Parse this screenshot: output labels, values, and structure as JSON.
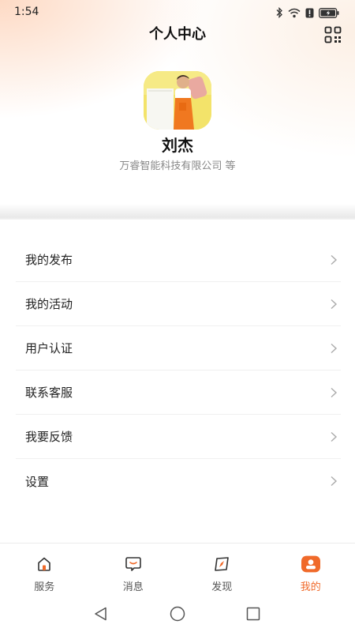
{
  "status_bar": {
    "time": "1:54"
  },
  "header": {
    "title": "个人中心"
  },
  "profile": {
    "name": "刘杰",
    "organization": "万睿智能科技有限公司 等"
  },
  "menu": {
    "items": [
      {
        "label": "我的发布"
      },
      {
        "label": "我的活动"
      },
      {
        "label": "用户认证"
      },
      {
        "label": "联系客服"
      },
      {
        "label": "我要反馈"
      },
      {
        "label": "设置"
      }
    ]
  },
  "tabbar": {
    "tabs": [
      {
        "label": "服务",
        "icon": "home-icon"
      },
      {
        "label": "消息",
        "icon": "message-icon"
      },
      {
        "label": "发现",
        "icon": "compass-icon"
      },
      {
        "label": "我的",
        "icon": "profile-icon",
        "active": true
      }
    ]
  },
  "colors": {
    "accent": "#f06a2a"
  }
}
